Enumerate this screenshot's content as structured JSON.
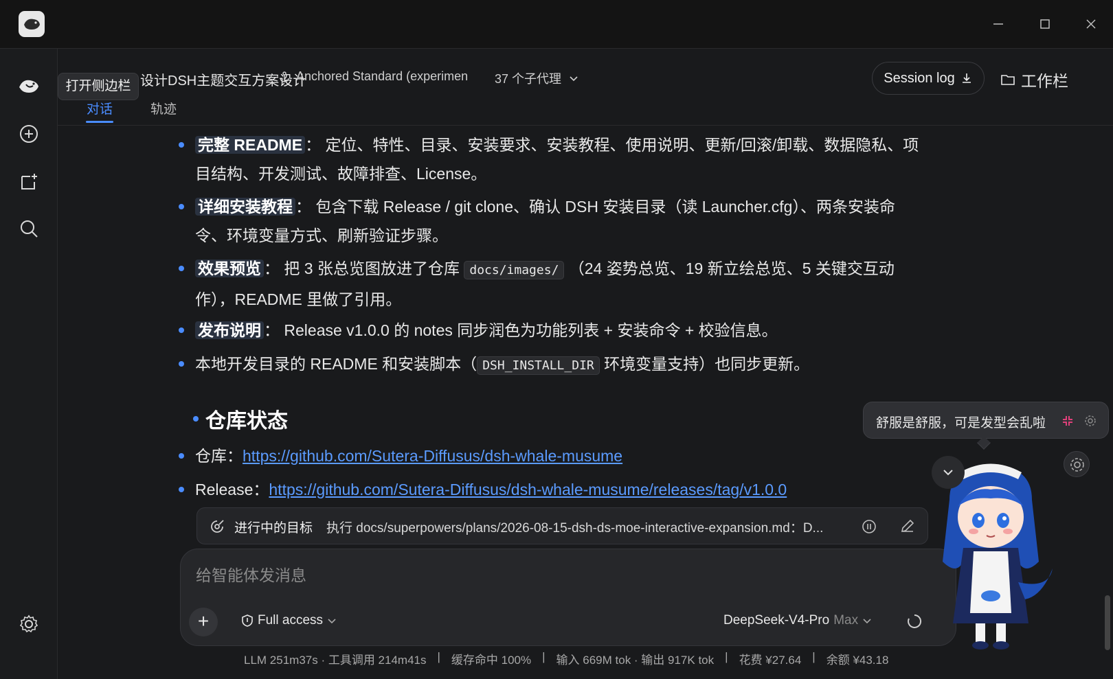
{
  "header": {
    "title": "设计DSH主题交互方案设计",
    "mode": "Anchored Standard (experimen",
    "agents": "37 个子代理",
    "session_log": "Session log",
    "workspace": "工作栏",
    "tabs": [
      "对话",
      "轨迹"
    ]
  },
  "sidebar": {
    "tooltip": "打开侧边栏"
  },
  "content": {
    "items": [
      {
        "label": "完整 README",
        "sep": "：",
        "line1": "定位、特性、目录、安装要求、安装教程、使用说明、更新/回滚/卸载、数据隐私、项",
        "line2": "目结构、开发测试、故障排查、License。"
      },
      {
        "label": "详细安装教程",
        "sep": "：",
        "line1": "包含下载 Release / git clone、确认 DSH 安装目录（读 Launcher.cfg）、两条安装命",
        "line2": "令、环境变量方式、刷新验证步骤。"
      },
      {
        "label": "效果预览",
        "sep": "：",
        "pre": "把 3 张总览图放进了仓库",
        "code": "docs/images/",
        "post": "（24 姿势总览、19 新立绘总览、5 关键交互动",
        "line2": "作），README 里做了引用。"
      },
      {
        "label": "发布说明",
        "sep": "：",
        "line1": "Release v1.0.0 的 notes 同步润色为功能列表 + 安装命令 + 校验信息。"
      },
      {
        "pre": "本地开发目录的 README 和安装脚本（",
        "code": "DSH_INSTALL_DIR",
        "post": "环境变量支持）也同步更新。"
      }
    ],
    "section_title": "仓库状态",
    "repo_label": "仓库：",
    "repo_url": "https://github.com/Sutera-Diffusus/dsh-whale-musume",
    "release_label": "Release：",
    "release_url": "https://github.com/Sutera-Diffusus/dsh-whale-musume/releases/tag/v1.0.0"
  },
  "goal": {
    "label": "进行中的目标",
    "text": "执行 docs/superpowers/plans/2026-08-15-dsh-ds-moe-interactive-expansion.md：D..."
  },
  "composer": {
    "placeholder": "给智能体发消息",
    "access": "Full access",
    "model": "DeepSeek-V4-Pro",
    "tier": "Max"
  },
  "status": {
    "llm": "LLM 251m37s · 工具调用 214m41s",
    "cache": "缓存命中 100%",
    "tokens": "输入 669M tok · 输出 917K tok",
    "cost": "花费 ¥27.64",
    "balance": "余额 ¥43.18",
    "sep": "|"
  },
  "mascot": {
    "speech": "舒服是舒服，可是发型会乱啦"
  }
}
